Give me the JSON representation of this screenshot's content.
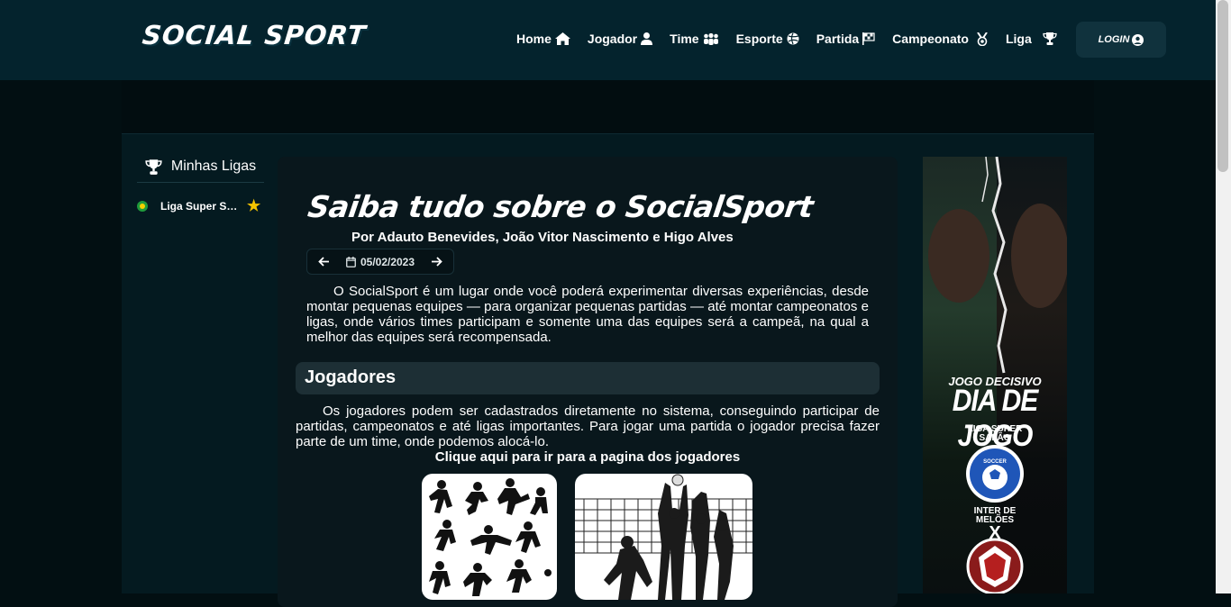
{
  "header": {
    "logo": "SOCIAL SPORT",
    "nav": [
      {
        "label": "Home",
        "icon": "home-icon"
      },
      {
        "label": "Jogador",
        "icon": "user-icon"
      },
      {
        "label": "Time",
        "icon": "users-icon"
      },
      {
        "label": "Esporte",
        "icon": "volleyball-icon"
      },
      {
        "label": "Partida",
        "icon": "flag-checkered-icon"
      },
      {
        "label": "Campeonato",
        "icon": "medal-icon"
      },
      {
        "label": "Liga",
        "icon": "trophy-icon"
      }
    ],
    "login": "LOGIN"
  },
  "sidebar": {
    "title": "Minhas Ligas",
    "leagues": [
      {
        "name": "Liga Super Salão",
        "favorite": true
      }
    ]
  },
  "article": {
    "title": "Saiba tudo sobre o SocialSport",
    "authors": "Por Adauto Benevides, João Vitor Nascimento e Higo Alves",
    "date": "05/02/2023",
    "intro": "O SocialSport é um lugar onde você poderá experimentar diversas experiências, desde montar pequenas equipes — para organizar pequenas partidas — até montar campeonatos e ligas, onde vários times participam e somente uma das equipes será a campeã, na qual a melhor das equipes será recompensada.",
    "section_title": "Jogadores",
    "section_text": "Os jogadores podem ser cadastrados diretamente no sistema, conseguindo participar de partidas, campeonatos e até ligas importantes. Para jogar uma partida o jogador precisa fazer parte de um time, onde podemos alocá-lo.",
    "section_link": "Clique aqui para ir para a pagina dos jogadores"
  },
  "ad": {
    "line1": "JOGO DECISIVO",
    "line2": "DIA DE JOGO",
    "league": [
      "LIGA SUPER",
      "SALÃO"
    ],
    "badge_text": "SOCCER",
    "team": [
      "INTER DE",
      "MELÕES"
    ],
    "versus": "X"
  },
  "colors": {
    "navbar": "#04232d",
    "background": "#020f12",
    "card": "#09171c",
    "star": "#f5c400"
  }
}
